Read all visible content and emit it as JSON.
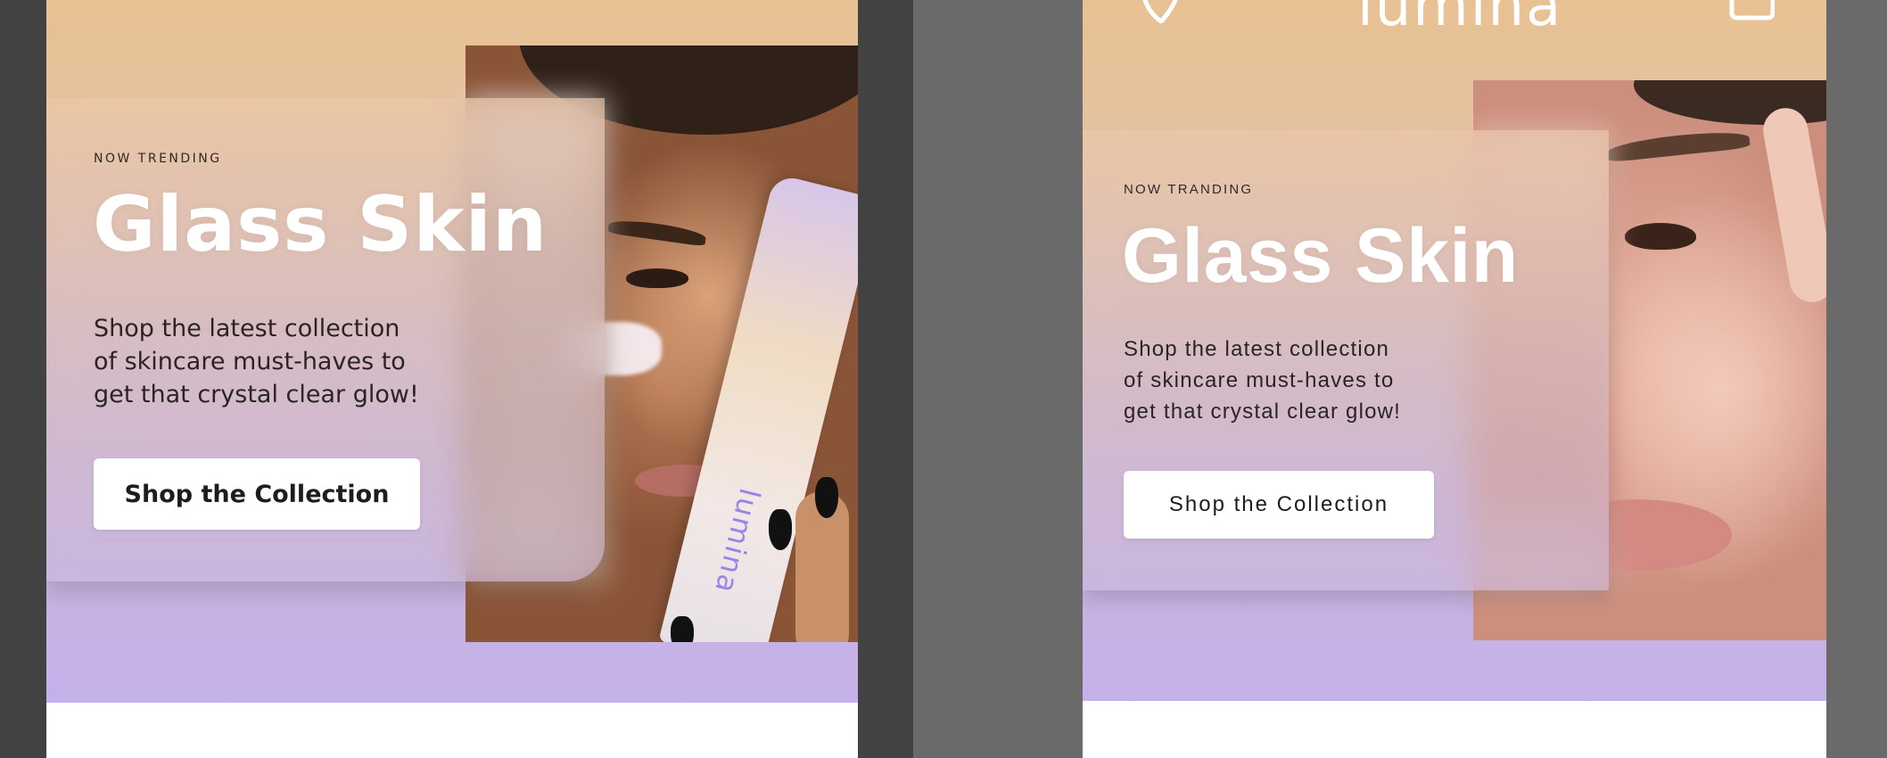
{
  "artboards": [
    {
      "eyebrow": "NOW TRENDING",
      "title": "Glass Skin",
      "description": "Shop the latest collection\nof skincare must-haves to\nget that crystal clear glow!",
      "cta_label": "Shop the Collection",
      "product_text": "lumina"
    },
    {
      "eyebrow": "NOW TRANDING",
      "title": "Glass Skin",
      "description": "Shop the latest collection\nof skincare must-haves to\nget that crystal clear glow!",
      "cta_label": "Shop the Collection",
      "brand_logo": "lumina",
      "icons": {
        "left": "chat-bubble-icon",
        "right": "shopping-bag-icon"
      }
    }
  ],
  "colors": {
    "gradient_top": "#e8c193",
    "gradient_bottom": "#c5b1eb",
    "canvas_left": "#424242",
    "canvas_right": "#6a6a6a",
    "button_bg": "#ffffff",
    "title_color": "#ffffff"
  }
}
